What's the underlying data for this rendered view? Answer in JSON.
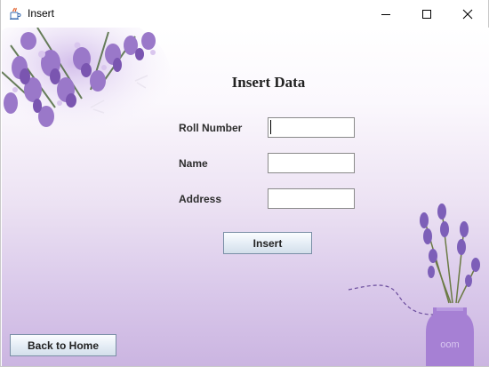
{
  "window": {
    "title": "Insert",
    "icon": "java-cup-icon",
    "controls": [
      "minimize-icon",
      "maximize-icon",
      "close-icon"
    ]
  },
  "form": {
    "heading": "Insert Data",
    "fields": [
      {
        "label": "Roll Number",
        "value": "",
        "focused": true
      },
      {
        "label": "Name",
        "value": ""
      },
      {
        "label": "Address",
        "value": ""
      }
    ],
    "submit_label": "Insert"
  },
  "footer": {
    "back_label": "Back to Home"
  },
  "decor": {
    "vase_text": "oom"
  },
  "colors": {
    "lavender": "#9b72c8",
    "background_bottom": "#cbb5e1"
  }
}
